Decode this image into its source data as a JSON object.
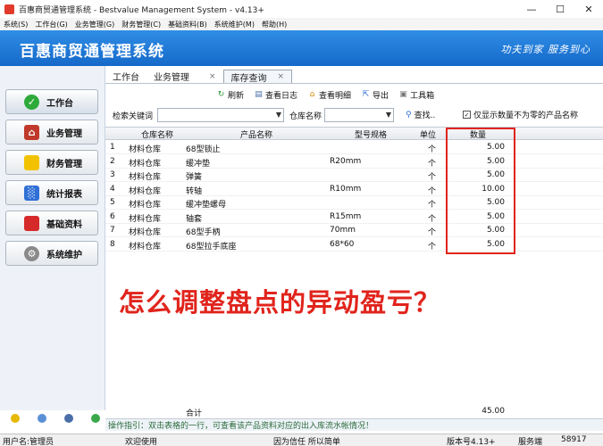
{
  "window": {
    "title": "百惠商贸通管理系统 - Bestvalue Management System - v4.13+",
    "controls": [
      "minimize",
      "maximize",
      "close"
    ]
  },
  "menu": [
    "系统(S)",
    "工作台(G)",
    "业务管理(G)",
    "财务管理(C)",
    "基础资料(B)",
    "系统维护(M)",
    "帮助(H)"
  ],
  "banner": {
    "brand": "百惠商贸通管理系统",
    "slogan": "功夫到家 服务到心"
  },
  "sidebar": {
    "items": [
      {
        "label": "工作台",
        "icon": "check-circle-icon",
        "color": "#2eaa3a"
      },
      {
        "label": "业务管理",
        "icon": "house-icon",
        "color": "#c0392b"
      },
      {
        "label": "财务管理",
        "icon": "folder-icon",
        "color": "#f2c200"
      },
      {
        "label": "统计报表",
        "icon": "bar-chart-icon",
        "color": "#2f6fd6"
      },
      {
        "label": "基础资料",
        "icon": "book-icon",
        "color": "#d62a2a"
      },
      {
        "label": "系统维护",
        "icon": "gear-icon",
        "color": "#8a8a8a"
      }
    ]
  },
  "tabs": [
    {
      "label": "工作台",
      "closable": false,
      "active": false
    },
    {
      "label": "业务管理",
      "closable": true,
      "active": false
    },
    {
      "label": "库存查询",
      "closable": true,
      "active": true
    }
  ],
  "toolbar": {
    "refresh": "刷新",
    "view_log": "查看日志",
    "view_detail": "查看明细",
    "export": "导出",
    "toolbox": "工具箱"
  },
  "search": {
    "keyword_label": "检索关键词",
    "keyword_value": "",
    "warehouse_label": "仓库名称",
    "warehouse_value": "",
    "find_label": "查找..",
    "filter_checkbox_label": "仅显示数量不为零的产品名称",
    "filter_checked": true
  },
  "table": {
    "columns": [
      "仓库名称",
      "产品名称",
      "型号规格",
      "单位",
      "数量"
    ],
    "rows": [
      {
        "no": "1",
        "warehouse": "材料仓库",
        "product": "68型锁止",
        "model": "",
        "unit": "个",
        "qty": "5.00"
      },
      {
        "no": "2",
        "warehouse": "材料仓库",
        "product": "缓冲垫",
        "model": "R20mm",
        "unit": "个",
        "qty": "5.00"
      },
      {
        "no": "3",
        "warehouse": "材料仓库",
        "product": "弹簧",
        "model": "",
        "unit": "个",
        "qty": "5.00"
      },
      {
        "no": "4",
        "warehouse": "材料仓库",
        "product": "转轴",
        "model": "R10mm",
        "unit": "个",
        "qty": "10.00"
      },
      {
        "no": "5",
        "warehouse": "材料仓库",
        "product": "缓冲垫螺母",
        "model": "",
        "unit": "个",
        "qty": "5.00"
      },
      {
        "no": "6",
        "warehouse": "材料仓库",
        "product": "轴套",
        "model": "R15mm",
        "unit": "个",
        "qty": "5.00"
      },
      {
        "no": "7",
        "warehouse": "材料仓库",
        "product": "68型手柄",
        "model": "70mm",
        "unit": "个",
        "qty": "5.00"
      },
      {
        "no": "8",
        "warehouse": "材料仓库",
        "product": "68型拉手底座",
        "model": "68*60",
        "unit": "个",
        "qty": "5.00"
      }
    ],
    "total_label": "合计",
    "total_value": "45.00",
    "highlight_color": "#e0241c"
  },
  "overlay_question": "怎么调整盘点的异动盈亏？",
  "hint": "操作指引：双击表格的一行，可查看该产品资料对应的出入库流水帐情况！",
  "statusbar": {
    "user": "用户名:管理员",
    "welcome": "欢迎使用",
    "motto": "因为信任 所以简单",
    "version": "版本号4.13+",
    "service_label": "服务端",
    "service_value": "58917"
  }
}
